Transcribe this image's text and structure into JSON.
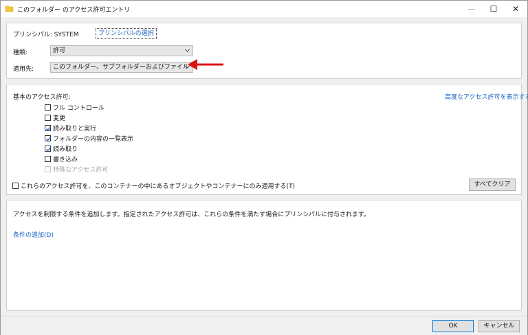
{
  "window": {
    "title": "このフォルダー のアクセス許可エントリ",
    "controls": {
      "minimize": "—",
      "maximize": "☐",
      "close": "✕"
    }
  },
  "principal": {
    "label": "プリンシパル: SYSTEM",
    "select_link": "プリンシパルの選択"
  },
  "type": {
    "label": "種類:",
    "value": "許可"
  },
  "applies_to": {
    "label": "適用先:",
    "value": "このフォルダー、サブフォルダーおよびファイル"
  },
  "permissions": {
    "heading": "基本のアクセス許可:",
    "advanced_link": "高度なアクセス許可を表示する",
    "items": [
      {
        "label": "フル コントロール",
        "checked": false,
        "disabled": false
      },
      {
        "label": "変更",
        "checked": false,
        "disabled": false
      },
      {
        "label": "読み取りと実行",
        "checked": true,
        "disabled": false
      },
      {
        "label": "フォルダーの内容の一覧表示",
        "checked": true,
        "disabled": false
      },
      {
        "label": "読み取り",
        "checked": true,
        "disabled": false
      },
      {
        "label": "書き込み",
        "checked": false,
        "disabled": false
      },
      {
        "label": "特殊なアクセス許可",
        "checked": false,
        "disabled": true
      }
    ],
    "apply_only": "これらのアクセス許可を、このコンテナーの中にあるオブジェクトやコンテナーにのみ適用する(T)",
    "clear_all": "すべてクリア"
  },
  "conditions": {
    "description": "アクセスを制限する条件を追加します。指定されたアクセス許可は、これらの条件を満たす場合にプリンシパルに付与されます。",
    "add_link": "条件の追加(D)"
  },
  "buttons": {
    "ok": "OK",
    "cancel": "キャンセル"
  },
  "colors": {
    "link": "#1a64c4",
    "annotation_arrow": "#e01010",
    "ok_border": "#0078d7"
  }
}
